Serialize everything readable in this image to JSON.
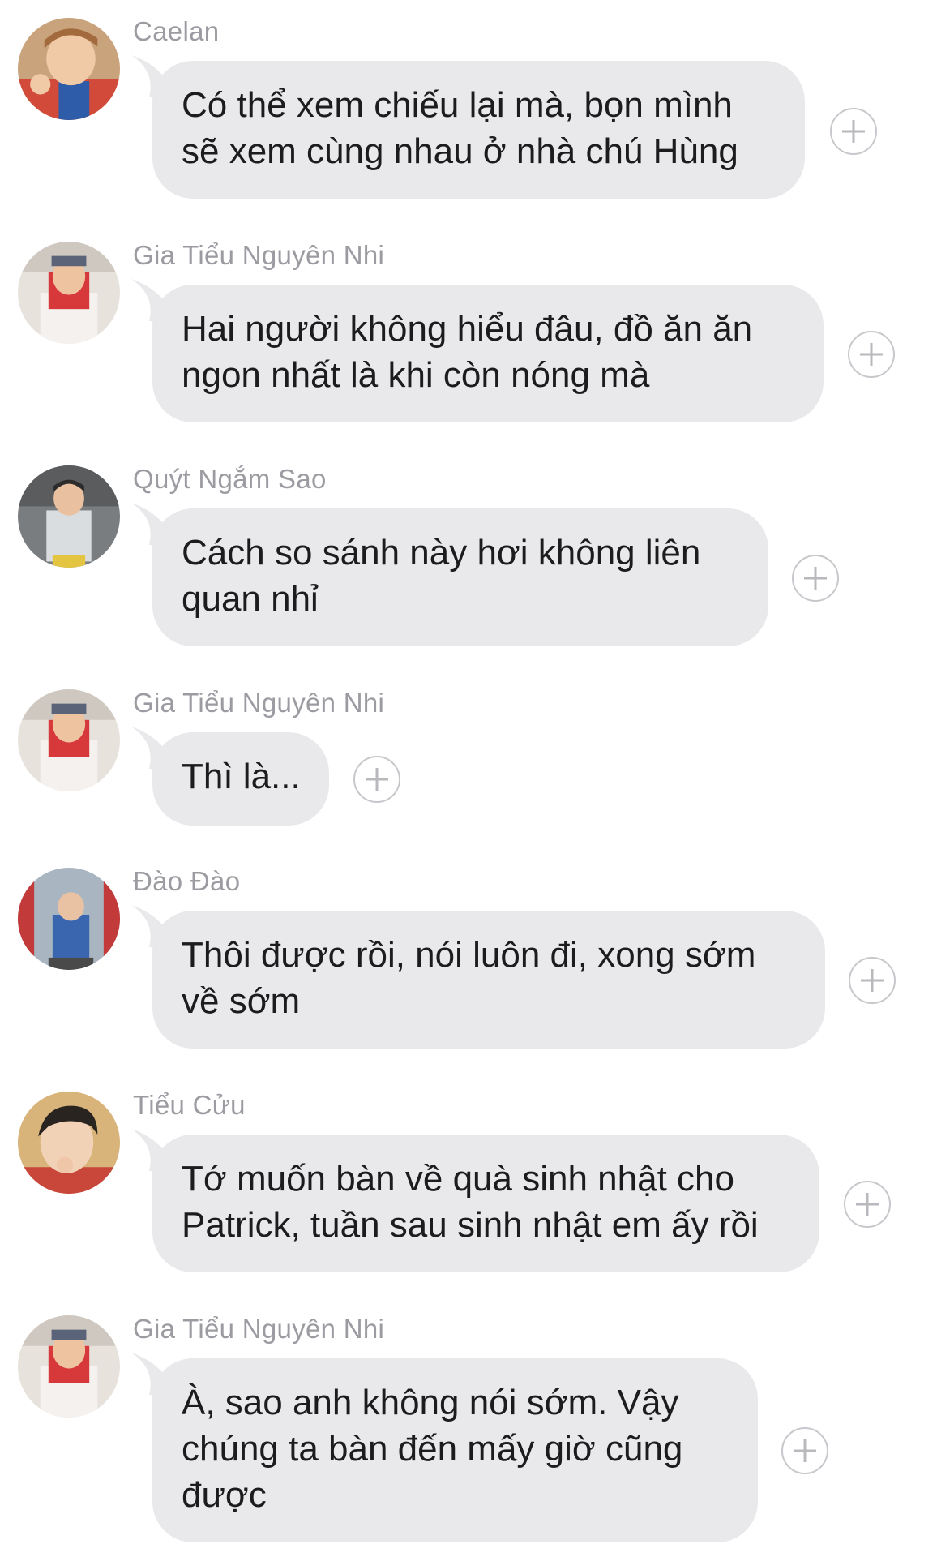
{
  "messages": [
    {
      "sender": "Caelan",
      "avatar": "avatar-caelan",
      "lines": [
        "Có thể xem chiếu lại mà, bọn mình",
        "sẽ xem cùng nhau ở nhà chú Hùng"
      ]
    },
    {
      "sender": "Gia Tiểu Nguyên Nhi",
      "avatar": "avatar-gia-tieu-nguyen-nhi",
      "lines": [
        "Hai người không hiểu đâu, đồ ăn ăn",
        "ngon nhất là khi còn nóng mà"
      ]
    },
    {
      "sender": "Quýt Ngắm Sao",
      "avatar": "avatar-quyt-ngam-sao",
      "lines": [
        "Cách so sánh này hơi không liên",
        "quan nhỉ"
      ]
    },
    {
      "sender": "Gia Tiểu Nguyên Nhi",
      "avatar": "avatar-gia-tieu-nguyen-nhi",
      "lines": [
        "Thì là..."
      ]
    },
    {
      "sender": "Đào Đào",
      "avatar": "avatar-dao-dao",
      "lines": [
        "Thôi được rồi, nói luôn đi, xong sớm",
        "về sớm"
      ]
    },
    {
      "sender": "Tiểu Cửu",
      "avatar": "avatar-tieu-cuu",
      "lines": [
        "Tớ muốn bàn về quà sinh nhật cho",
        "Patrick, tuần sau sinh nhật em ấy rồi"
      ]
    },
    {
      "sender": "Gia Tiểu Nguyên Nhi",
      "avatar": "avatar-gia-tieu-nguyen-nhi",
      "lines": [
        "À, sao anh không nói sớm. Vậy",
        "chúng ta bàn đến mấy giờ cũng",
        "được"
      ]
    }
  ],
  "colors": {
    "bubble": "#e9e9ec",
    "sender_text": "#9b9ba1",
    "message_text": "#1c1c1e",
    "add_icon": "#c7c7cc"
  },
  "icons": {
    "add_reaction": "plus-circle-icon"
  }
}
